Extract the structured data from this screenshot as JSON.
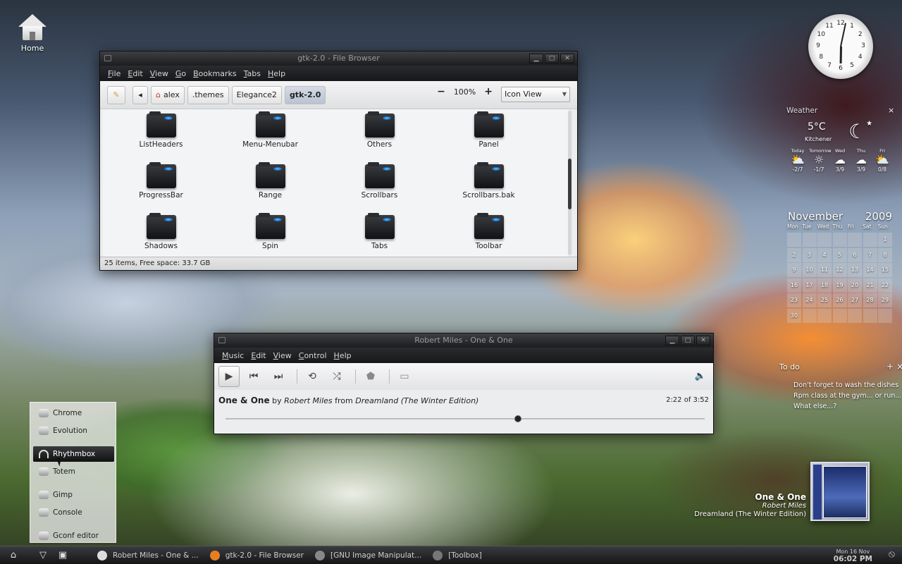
{
  "desktop": {
    "home_label": "Home"
  },
  "file_browser": {
    "title": "gtk-2.0 - File Browser",
    "menu": [
      "File",
      "Edit",
      "View",
      "Go",
      "Bookmarks",
      "Tabs",
      "Help"
    ],
    "breadcrumbs": [
      "alex",
      ".themes",
      "Elegance2",
      "gtk-2.0"
    ],
    "zoom": "100%",
    "zoom_out": "−",
    "zoom_in": "+",
    "view_mode": "Icon View",
    "items": [
      "ListHeaders",
      "Menu-Menubar",
      "Others",
      "Panel",
      "ProgressBar",
      "Range",
      "Scrollbars",
      "Scrollbars.bak",
      "Shadows",
      "Spin",
      "Tabs",
      "Toolbar"
    ],
    "status": "25 items, Free space: 33.7 GB",
    "scroll_position": 0.33
  },
  "player": {
    "title": "Robert Miles - One & One",
    "menu": [
      "Music",
      "Edit",
      "View",
      "Control",
      "Help"
    ],
    "track_title": "One & One",
    "by_label": "by",
    "artist": "Robert Miles",
    "from_label": "from",
    "album": "Dreamland (The Winter Edition)",
    "time": "2:22 of 3:52",
    "progress": 0.61
  },
  "clock_widget": {
    "hour": 6,
    "minute": 2,
    "numbers": [
      "12",
      "1",
      "2",
      "3",
      "4",
      "5",
      "6",
      "7",
      "8",
      "9",
      "10",
      "11"
    ]
  },
  "weather": {
    "title": "Weather",
    "close": "×",
    "temp": "5°C",
    "city": "Kitchener",
    "forecast": [
      {
        "day": "Today",
        "range": "-2/7",
        "icon": "cloud-sun-icon"
      },
      {
        "day": "Tomorrow",
        "range": "-1/7",
        "icon": "sun-icon"
      },
      {
        "day": "Wed",
        "range": "3/9",
        "icon": "cloud-icon"
      },
      {
        "day": "Thu",
        "range": "3/9",
        "icon": "cloud-icon"
      },
      {
        "day": "Fri",
        "range": "0/8",
        "icon": "cloud-sun-icon"
      }
    ]
  },
  "calendar": {
    "month": "November",
    "year": "2009",
    "weekdays": [
      "Mon",
      "Tue",
      "Wed",
      "Thu",
      "Fri",
      "Sat",
      "Sun"
    ],
    "days": [
      "",
      "",
      "",
      "",
      "",
      "",
      "1",
      "2",
      "3",
      "4",
      "5",
      "6",
      "7",
      "8",
      "9",
      "10",
      "11",
      "12",
      "13",
      "14",
      "15",
      "16",
      "17",
      "18",
      "19",
      "20",
      "21",
      "22",
      "23",
      "24",
      "25",
      "26",
      "27",
      "28",
      "29",
      "30",
      "",
      "",
      "",
      "",
      "",
      ""
    ]
  },
  "todo": {
    "title": "To do",
    "add": "+",
    "close": "×",
    "items": [
      "Don't forget to wash the dishes",
      "Rpm class at the gym... or run...",
      "What else...?"
    ]
  },
  "now_playing": {
    "title": "One & One",
    "artist": "Robert Miles",
    "album": "Dreamland (The Winter Edition)"
  },
  "app_menu": [
    {
      "label": "Chrome",
      "icon": "chrome-icon"
    },
    {
      "label": "Evolution",
      "icon": "mail-icon"
    },
    {
      "label": "Rhythmbox",
      "icon": "headphones-icon",
      "selected": true
    },
    {
      "label": "Totem",
      "icon": "film-icon"
    },
    {
      "label": "Gimp",
      "icon": "gimp-icon"
    },
    {
      "label": "Console",
      "icon": "terminal-icon"
    },
    {
      "label": "Gconf editor",
      "icon": "wrench-icon"
    }
  ],
  "taskbar": {
    "tasks": [
      "Robert Miles - One & ...",
      "gtk-2.0 - File Browser",
      "[GNU Image Manipulat...",
      "[Toolbox]"
    ],
    "date": "Mon 16 Nov",
    "time": "06:02 PM"
  }
}
